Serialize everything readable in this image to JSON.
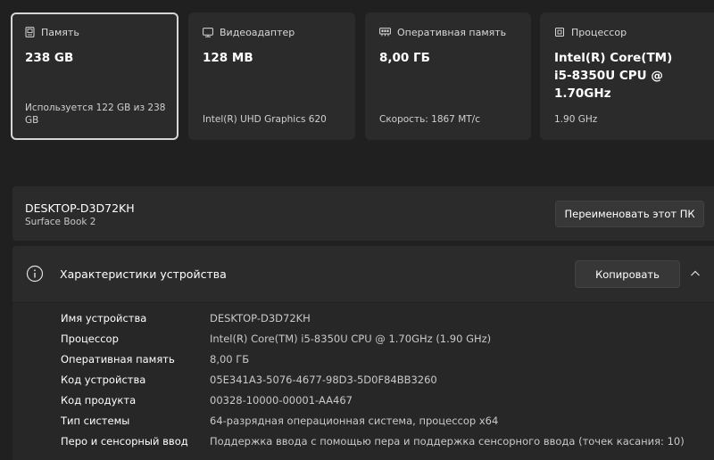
{
  "cards": [
    {
      "icon": "storage-icon",
      "label": "Память",
      "value": "238 GB",
      "sub": "Используется 122 GB из 238 GB",
      "selected": true
    },
    {
      "icon": "gpu-icon",
      "label": "Видеоадаптер",
      "value": "128 MB",
      "sub": "Intel(R) UHD Graphics 620"
    },
    {
      "icon": "ram-icon",
      "label": "Оперативная память",
      "value": "8,00 ГБ",
      "sub": "Скорость: 1867 MT/c"
    },
    {
      "icon": "cpu-icon",
      "label": "Процессор",
      "value": "Intel(R) Core(TM) i5-8350U CPU @ 1.70GHz",
      "sub": "1.90 GHz"
    }
  ],
  "device": {
    "name": "DESKTOP-D3D72KH",
    "model": "Surface Book 2",
    "rename_label": "Переименовать этот ПК"
  },
  "specs": {
    "title": "Характеристики устройства",
    "copy_label": "Копировать",
    "rows": [
      {
        "key": "Имя устройства",
        "value": "DESKTOP-D3D72KH"
      },
      {
        "key": "Процессор",
        "value": "Intel(R) Core(TM) i5-8350U CPU @ 1.70GHz (1.90 GHz)"
      },
      {
        "key": "Оперативная память",
        "value": "8,00 ГБ"
      },
      {
        "key": "Код устройства",
        "value": "05E341A3-5076-4677-98D3-5D0F84BB3260"
      },
      {
        "key": "Код продукта",
        "value": "00328-10000-00001-AA467"
      },
      {
        "key": "Тип системы",
        "value": "64-разрядная операционная система, процессор x64"
      },
      {
        "key": "Перо и сенсорный ввод",
        "value": "Поддержка ввода с помощью пера и поддержка сенсорного ввода (точек касания: 10)"
      }
    ]
  },
  "colors": {
    "background": "#202020",
    "card": "#2b2b2b",
    "selected_border": "#d6d6d6"
  }
}
